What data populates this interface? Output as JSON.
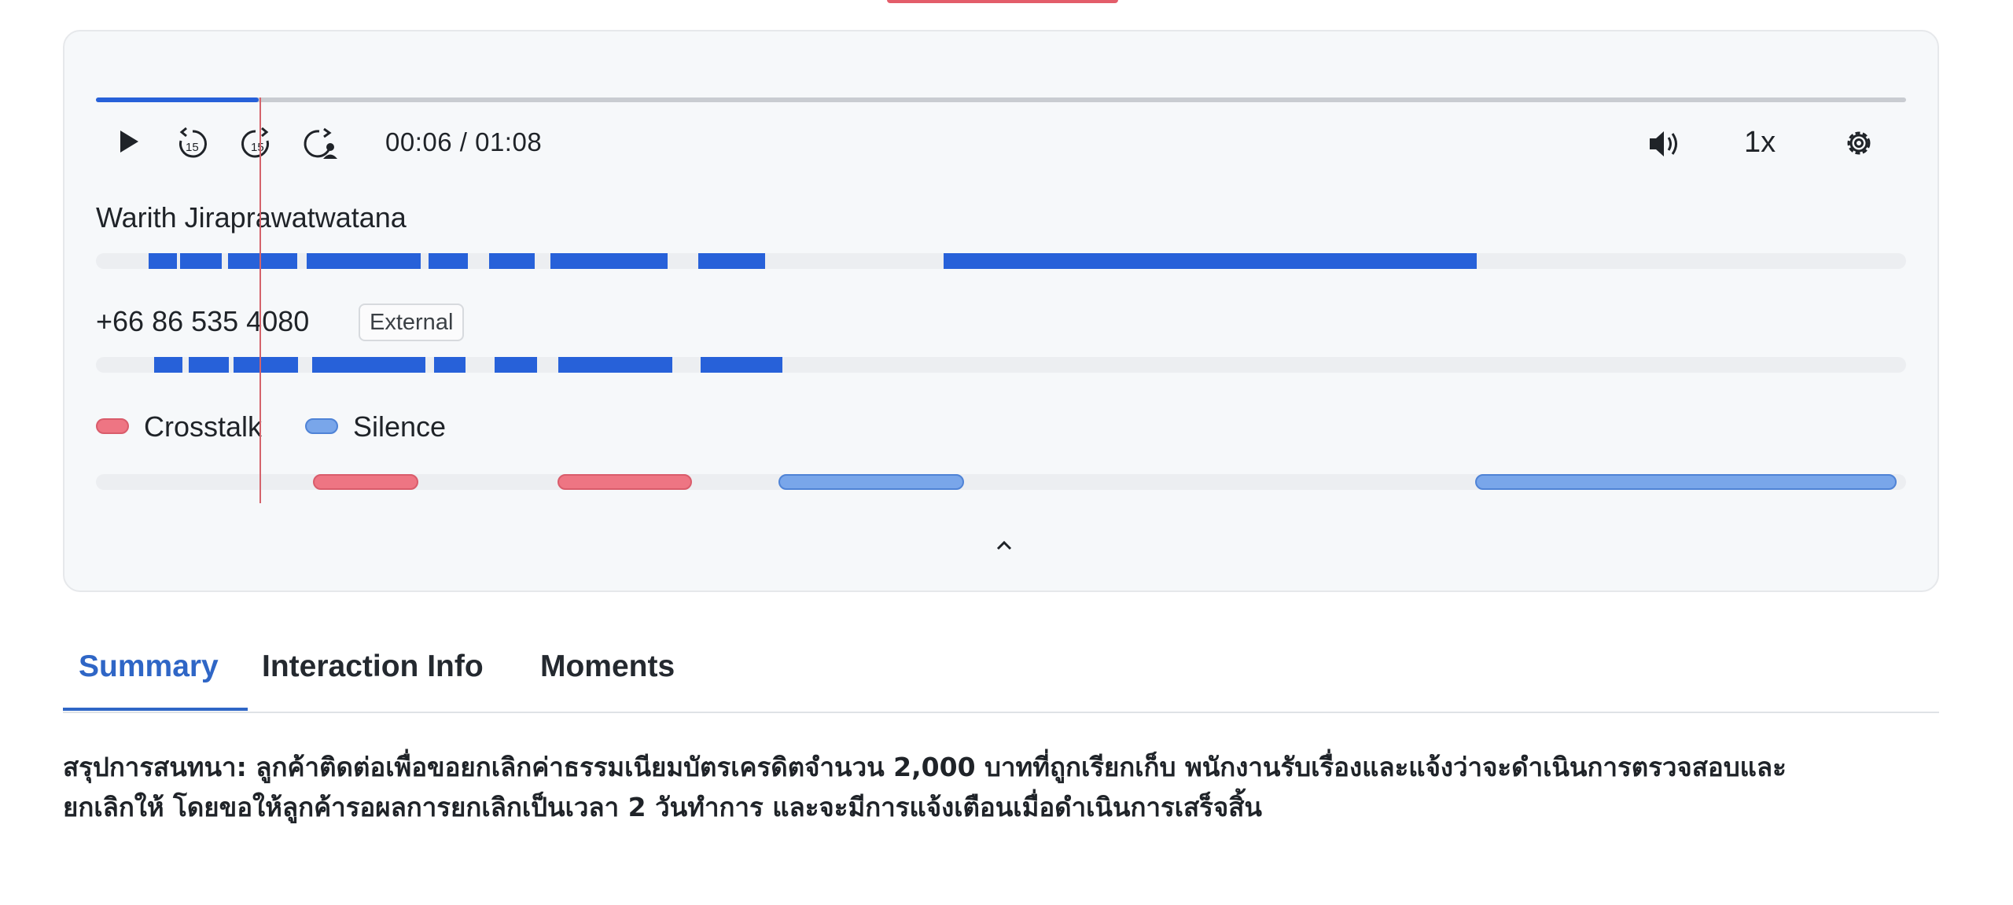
{
  "player": {
    "time_display": "00:06 / 01:08",
    "progress_fraction": 0.09,
    "speed_label": "1x",
    "icons": [
      "play-icon",
      "rewind-15-icon",
      "forward-15-icon",
      "skip-speaker-icon",
      "volume-icon",
      "gear-icon",
      "chevron-up-icon"
    ]
  },
  "speakers": [
    {
      "name": "Warith Jiraprawatwatana",
      "badge": ""
    },
    {
      "name": "+66 86 535 4080",
      "badge": "External"
    }
  ],
  "legend": {
    "crosstalk": "Crosstalk",
    "silence": "Silence"
  },
  "colors": {
    "accent": "#2761d9",
    "crosstalk": "#ee7583",
    "silence": "#79a6ea",
    "playhead": "#d4636b"
  },
  "tabs": [
    {
      "label": "Summary",
      "active": true
    },
    {
      "label": "Interaction Info",
      "active": false
    },
    {
      "label": "Moments",
      "active": false
    }
  ],
  "summary": {
    "line1": "สรุปการสนทนา: ลูกค้าติดต่อเพื่อขอยกเลิกค่าธรรมเนียมบัตรเครดิตจำนวน 2,000 บาทที่ถูกเรียกเก็บ พนักงานรับเรื่องและแจ้งว่าจะดำเนินการตรวจสอบและ",
    "line2": "ยกเลิกให้ โดยขอให้ลูกค้ารอผลการยกเลิกเป็นเวลา 2 วันทำการ และจะมีการแจ้งเตือนเมื่อดำเนินการเสร็จสิ้น"
  }
}
